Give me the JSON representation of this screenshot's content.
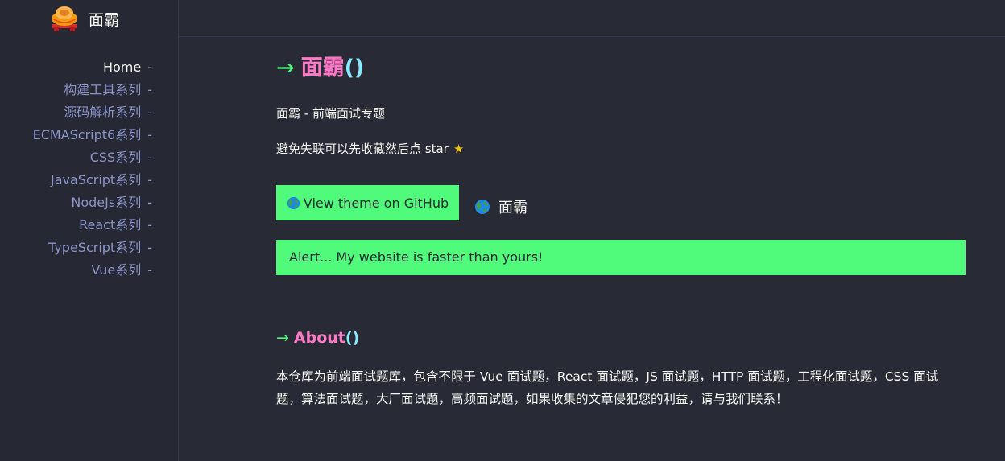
{
  "brand": {
    "name": "面霸",
    "logo_icon": "ingot-logo-icon"
  },
  "sidebar": {
    "items": [
      {
        "label": "Home",
        "active": true
      },
      {
        "label": "构建工具系列",
        "active": false
      },
      {
        "label": "源码解析系列",
        "active": false
      },
      {
        "label": "ECMAScript6系列",
        "active": false
      },
      {
        "label": "CSS系列",
        "active": false
      },
      {
        "label": "JavaScript系列",
        "active": false
      },
      {
        "label": "NodeJs系列",
        "active": false
      },
      {
        "label": "React系列",
        "active": false
      },
      {
        "label": "TypeScript系列",
        "active": false
      },
      {
        "label": "Vue系列",
        "active": false
      }
    ],
    "dash": "-"
  },
  "main": {
    "heading": {
      "arrow": "→",
      "title": "面霸",
      "paren": "()"
    },
    "intro": "面霸 - 前端面试专题",
    "star_note": {
      "text": "避免失联可以先收藏然后点 star",
      "icon": "★"
    },
    "github_button": {
      "label": "View theme on GitHub",
      "icon": "globe-icon"
    },
    "github_link": {
      "label": "面霸",
      "icon": "globe-icon"
    },
    "alert": "Alert... My website is faster than yours!",
    "about": {
      "heading": {
        "arrow": "→",
        "title": "About",
        "paren": "()"
      },
      "text": "本仓库为前端面试题库，包含不限于 Vue 面试题，React 面试题，JS 面试题，HTTP 面试题，工程化面试题，CSS 面试题，算法面试题，大厂面试题，高频面试题，如果收集的文章侵犯您的利益，请与我们联系！"
    }
  },
  "colors": {
    "background": "#282a36",
    "accent_green": "#50fa7b",
    "accent_pink": "#ff79c6",
    "accent_cyan": "#8be9fd",
    "nav_link": "#8b95c9"
  }
}
